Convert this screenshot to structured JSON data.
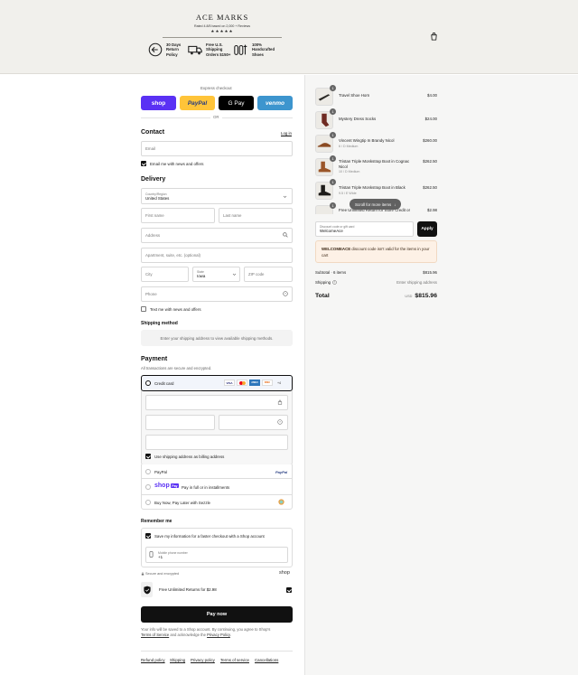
{
  "header": {
    "brand": "ACE MARKS",
    "rating": "Rated 4.8/5 based on 2,000 + Reviews",
    "stars": "★★★★★",
    "badges": [
      {
        "icon": "return-icon",
        "line1": "30 Days",
        "line2": "Return",
        "line3": "Policy"
      },
      {
        "icon": "truck-icon",
        "line1": "Free U.S.",
        "line2": "Shipping",
        "line3": "Orders $150+"
      },
      {
        "icon": "shoe-tools-icon",
        "line1": "100%",
        "line2": "Handcrafted",
        "line3": "Shoes"
      }
    ]
  },
  "express": {
    "label": "Express checkout",
    "shop": "shop",
    "paypal": "PayPal",
    "gpay": "G Pay",
    "venmo": "venmo",
    "or": "OR"
  },
  "contact": {
    "title": "Contact",
    "login": "Log in",
    "email_placeholder": "Email",
    "news_label": "Email me with news and offers"
  },
  "delivery": {
    "title": "Delivery",
    "country_label": "Country/Region",
    "country_value": "United States",
    "first_name": "First name",
    "last_name": "Last name",
    "address": "Address",
    "apartment": "Apartment, suite, etc. (optional)",
    "city": "City",
    "state_label": "State",
    "state_value": "Iowa",
    "zip": "ZIP code",
    "phone": "Phone",
    "text_label": "Text me with news and offers"
  },
  "shipping": {
    "title": "Shipping method",
    "placeholder": "Enter your shipping address to view available shipping methods."
  },
  "payment": {
    "title": "Payment",
    "subtitle": "All transactions are secure and encrypted.",
    "credit_card": "Credit card",
    "cards": [
      "VISA",
      "MC",
      "AMEX",
      "DISC",
      "+4"
    ],
    "billing_label": "Use shipping address as billing address",
    "paypal": "PayPal",
    "shop_pay": "Pay in full or in installments",
    "sezzle": "Buy Now, Pay Later with Sezzle"
  },
  "remember": {
    "title": "Remember me",
    "save_label": "Save my information for a faster checkout with a Shop account",
    "mobile_label": "Mobile phone number",
    "mobile_value": "+1",
    "secure": "Secure and encrypted",
    "shop": "shop"
  },
  "returns": {
    "label": "Free Unlimited Returns for $2.98"
  },
  "paynow": "Pay now",
  "legal": {
    "line1": "Your info will be saved to a Shop account. By continuing, you agree to Shop's",
    "terms": "Terms of Service",
    "mid": " and acknowledge the ",
    "privacy": "Privacy Policy",
    "end": "."
  },
  "footer": [
    "Refund policy",
    "Shipping",
    "Privacy policy",
    "Terms of service",
    "Cancellations"
  ],
  "cart": {
    "items": [
      {
        "qty": "1",
        "name": "Travel Shoe Horn",
        "variant": "",
        "price": "$4.00"
      },
      {
        "qty": "1",
        "name": "Mystery Dress Socks",
        "variant": "",
        "price": "$24.00"
      },
      {
        "qty": "1",
        "name": "Vincent Wingtip In Brandy Nicol",
        "variant": "6 / D Medium",
        "price": "$260.00"
      },
      {
        "qty": "1",
        "name": "Tristan Triple Monkstrap Boot in Cognac Nicol",
        "variant": "10 / D Medium",
        "price": "$262.50"
      },
      {
        "qty": "1",
        "name": "Tristan Triple Monkstrap Boot in Black",
        "variant": "9.5 / E Wide",
        "price": "$262.50"
      },
      {
        "qty": "1",
        "name": "Free Unlimited Return for Store Credit or",
        "variant": "",
        "price": "$2.98"
      }
    ],
    "scroll_tip": "Scroll for more items",
    "discount_label": "Discount code or gift card",
    "discount_value": "WelcomeAce",
    "apply": "Apply",
    "error_code": "WELCOMEACE",
    "error_text": " discount code isn't valid for the items in your cart",
    "subtotal_label": "Subtotal · 6 items",
    "subtotal_value": "$815.96",
    "shipping_label": "Shipping",
    "shipping_value": "Enter shipping address",
    "total_label": "Total",
    "currency": "USD",
    "total_value": "$815.96"
  }
}
